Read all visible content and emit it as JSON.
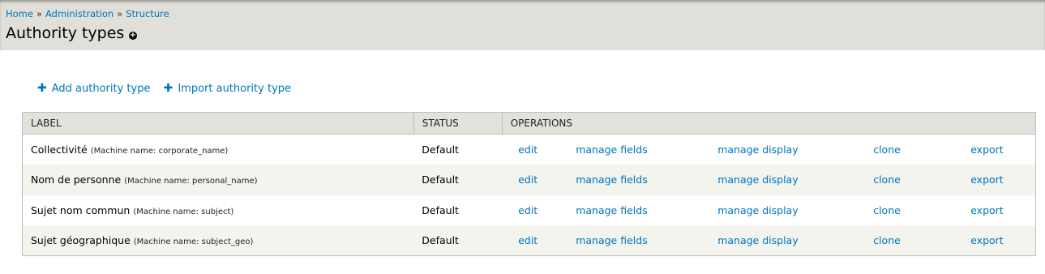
{
  "breadcrumb": {
    "home": "Home",
    "separator": "»",
    "administration": "Administration",
    "structure": "Structure"
  },
  "page": {
    "title": "Authority types",
    "shortcut_icon": "add-shortcut-icon"
  },
  "actions": {
    "add_label": "Add authority type",
    "import_label": "Import authority type",
    "icon": "plus-icon"
  },
  "table": {
    "headers": {
      "label": "LABEL",
      "status": "STATUS",
      "operations": "OPERATIONS"
    },
    "rows": [
      {
        "label": "Collectivité",
        "machine": "(Machine name: corporate_name)",
        "status": "Default",
        "ops": {
          "edit": "edit",
          "fields": "manage fields",
          "display": "manage display",
          "clone": "clone",
          "export": "export"
        }
      },
      {
        "label": "Nom de personne",
        "machine": "(Machine name: personal_name)",
        "status": "Default",
        "ops": {
          "edit": "edit",
          "fields": "manage fields",
          "display": "manage display",
          "clone": "clone",
          "export": "export"
        }
      },
      {
        "label": "Sujet nom commun",
        "machine": "(Machine name: subject)",
        "status": "Default",
        "ops": {
          "edit": "edit",
          "fields": "manage fields",
          "display": "manage display",
          "clone": "clone",
          "export": "export"
        }
      },
      {
        "label": "Sujet géographique",
        "machine": "(Machine name: subject_geo)",
        "status": "Default",
        "ops": {
          "edit": "edit",
          "fields": "manage fields",
          "display": "manage display",
          "clone": "clone",
          "export": "export"
        }
      }
    ]
  },
  "colors": {
    "link": "#0074bd",
    "header_bg": "#e0dfd9",
    "table_head_bg": "#e1e2dc",
    "row_alt_bg": "#f3f4ee",
    "border": "#bebfb9"
  }
}
